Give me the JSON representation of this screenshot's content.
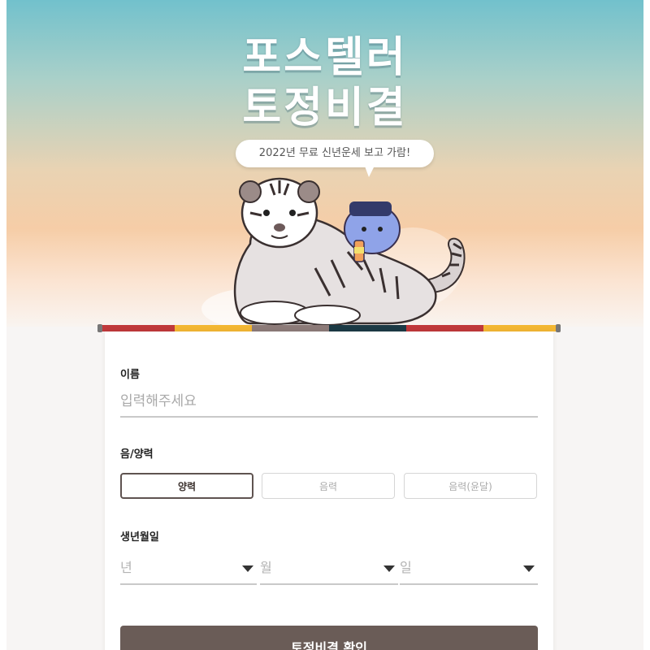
{
  "hero": {
    "title_line1": "포스텔러",
    "title_line2": "토정비결",
    "bubble_text": "2022년 무료 신년운세 보고 가람!",
    "gradient_top": "#72c1cc",
    "gradient_bottom": "#f6cda7"
  },
  "divider": {
    "colors": [
      "#c0393b",
      "#f3b733",
      "#8d7b79",
      "#1c3a45",
      "#c0393b",
      "#f3b733"
    ]
  },
  "form": {
    "name": {
      "label": "이름",
      "placeholder": "입력해주세요",
      "value": ""
    },
    "calendar": {
      "label": "음/양력",
      "options": [
        "양력",
        "음력",
        "음력(윤달)"
      ],
      "selected": "양력"
    },
    "birth": {
      "label": "생년월일",
      "year_placeholder": "년",
      "month_placeholder": "월",
      "day_placeholder": "일"
    },
    "submit_label": "토정비결 확인"
  },
  "colors": {
    "accent": "#6a5c57",
    "active_border": "#5f5350",
    "input_border": "#c9c9c9"
  },
  "icons": [
    "dropdown-arrow-icon"
  ]
}
